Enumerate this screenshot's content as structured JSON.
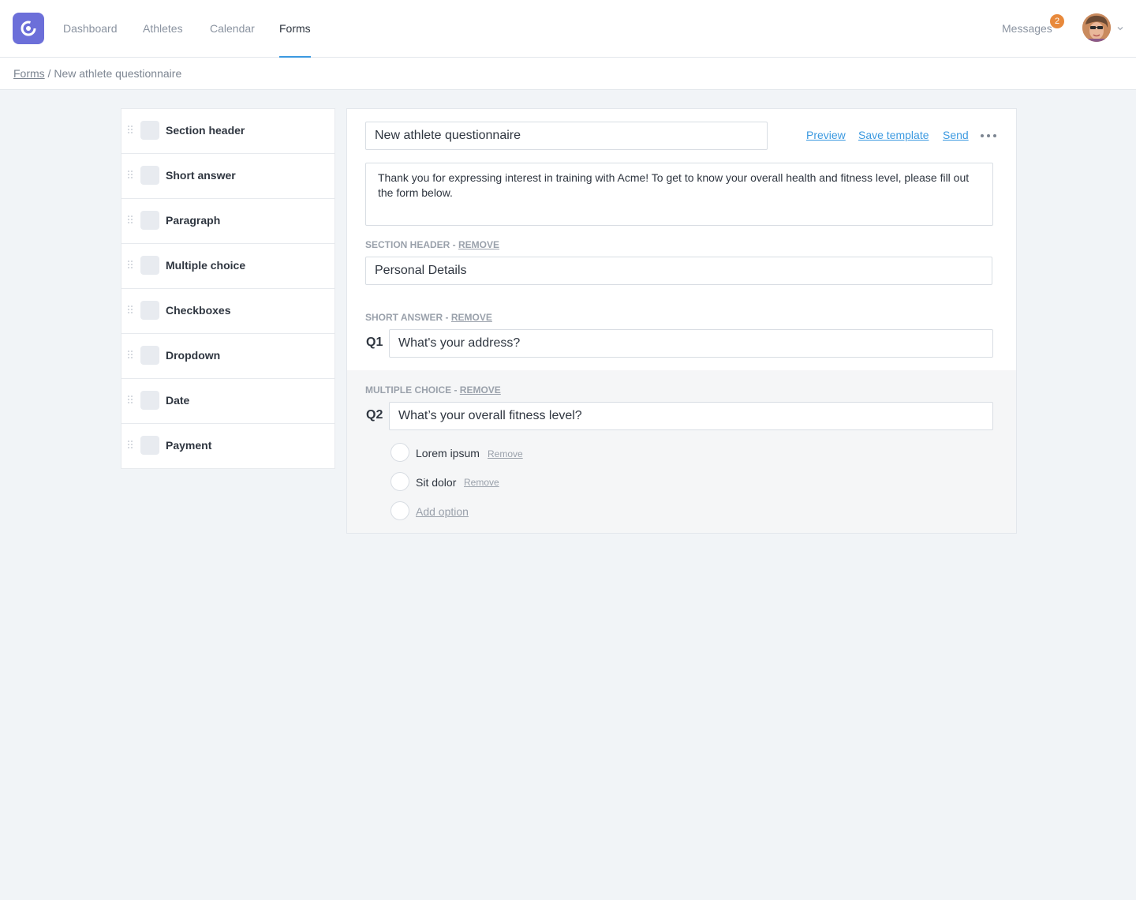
{
  "nav": {
    "items": [
      {
        "label": "Dashboard",
        "active": false
      },
      {
        "label": "Athletes",
        "active": false
      },
      {
        "label": "Calendar",
        "active": false
      },
      {
        "label": "Forms",
        "active": true
      }
    ],
    "messages_label": "Messages",
    "messages_count": "2",
    "accent_color": "#3b99e0",
    "badge_color": "#e8893b",
    "logo_color": "#6c6fd9"
  },
  "breadcrumb": {
    "root": "Forms",
    "separator": " / ",
    "current": "New athlete questionnaire"
  },
  "palette": {
    "items": [
      {
        "label": "Section header"
      },
      {
        "label": "Short answer"
      },
      {
        "label": "Paragraph"
      },
      {
        "label": "Multiple choice"
      },
      {
        "label": "Checkboxes"
      },
      {
        "label": "Dropdown"
      },
      {
        "label": "Date"
      },
      {
        "label": "Payment"
      }
    ]
  },
  "form": {
    "title": "New athlete questionnaire",
    "actions": {
      "preview": "Preview",
      "save_template": "Save template",
      "send": "Send"
    },
    "intro": "Thank  you for expressing interest in training with Acme! To get to know your overall health and fitness level, please fill out the form below.",
    "blocks": {
      "section": {
        "type_label": "SECTION HEADER - ",
        "remove": "REMOVE",
        "value": "Personal Details"
      },
      "q1": {
        "type_label": "SHORT ANSWER - ",
        "remove": "REMOVE",
        "number": "Q1",
        "value": "What's your address?"
      },
      "q2": {
        "type_label": "MULTIPLE CHOICE - ",
        "remove": "REMOVE",
        "number": "Q2",
        "value": "What’s your overall fitness level?",
        "options": [
          {
            "label": "Lorem ipsum",
            "remove": "Remove"
          },
          {
            "label": "Sit dolor",
            "remove": "Remove"
          }
        ],
        "add_option": "Add option"
      }
    }
  }
}
